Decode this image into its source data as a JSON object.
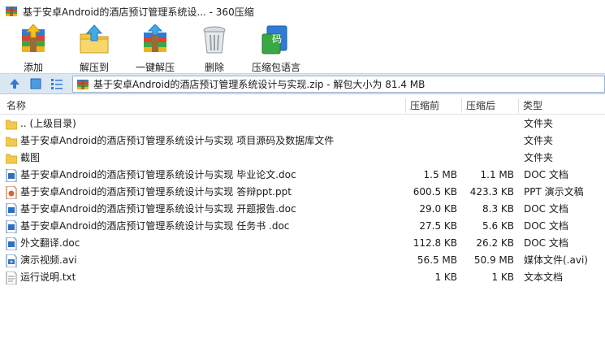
{
  "window": {
    "title": "基于安卓Android的酒店预订管理系统设... - 360压缩"
  },
  "toolbar": {
    "add_label": "添加",
    "extract_to_label": "解压到",
    "one_click_extract_label": "一键解压",
    "delete_label": "删除",
    "language_label": "压缩包语言"
  },
  "navbar": {
    "path": "基于安卓Android的酒店预订管理系统设计与实现.zip - 解包大小为 81.4 MB"
  },
  "columns": {
    "name": "名称",
    "packed": "压缩前",
    "compressed": "压缩后",
    "type": "类型"
  },
  "files": [
    {
      "icon": "folder-up-icon",
      "name": ".. (上级目录)",
      "before": "",
      "after": "",
      "type": "文件夹"
    },
    {
      "icon": "folder-icon",
      "name": "基于安卓Android的酒店预订管理系统设计与实现 项目源码及数据库文件",
      "before": "",
      "after": "",
      "type": "文件夹"
    },
    {
      "icon": "folder-icon",
      "name": "截图",
      "before": "",
      "after": "",
      "type": "文件夹"
    },
    {
      "icon": "doc-file-icon",
      "name": "基于安卓Android的酒店预订管理系统设计与实现 毕业论文.doc",
      "before": "1.5 MB",
      "after": "1.1 MB",
      "type": "DOC 文档"
    },
    {
      "icon": "ppt-file-icon",
      "name": "基于安卓Android的酒店预订管理系统设计与实现 答辩ppt.ppt",
      "before": "600.5 KB",
      "after": "423.3 KB",
      "type": "PPT 演示文稿"
    },
    {
      "icon": "doc-file-icon",
      "name": "基于安卓Android的酒店预订管理系统设计与实现 开题报告.doc",
      "before": "29.0 KB",
      "after": "8.3 KB",
      "type": "DOC 文档"
    },
    {
      "icon": "doc-file-icon",
      "name": "基于安卓Android的酒店预订管理系统设计与实现 任务书 .doc",
      "before": "27.5 KB",
      "after": "5.6 KB",
      "type": "DOC 文档"
    },
    {
      "icon": "doc-file-icon",
      "name": "外文翻译.doc",
      "before": "112.8 KB",
      "after": "26.2 KB",
      "type": "DOC 文档"
    },
    {
      "icon": "video-file-icon",
      "name": "演示视频.avi",
      "before": "56.5 MB",
      "after": "50.9 MB",
      "type": "媒体文件(.avi)"
    },
    {
      "icon": "txt-file-icon",
      "name": "运行说明.txt",
      "before": "1 KB",
      "after": "1 KB",
      "type": "文本文档"
    }
  ]
}
